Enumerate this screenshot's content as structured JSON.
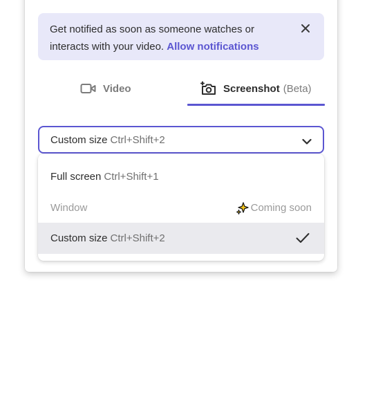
{
  "notification": {
    "message": "Get notified as soon as someone watches or interacts with your video.",
    "link": "Allow notifications",
    "close_icon": "close-icon"
  },
  "tabs": [
    {
      "label": "Video",
      "icon": "video-camera-icon",
      "selected": false
    },
    {
      "label": "Screenshot",
      "suffix": "(Beta)",
      "icon": "camera-icon",
      "selected": true
    }
  ],
  "capture_select": {
    "value": "Custom size",
    "shortcut": "Ctrl+Shift+2",
    "icon": "chevron-down-icon"
  },
  "capture_menu": {
    "items": [
      {
        "label": "Full screen",
        "shortcut": "Ctrl+Shift+1",
        "disabled": false,
        "selected": false
      },
      {
        "label": "Window",
        "badge": "Coming soon",
        "badge_icon": "sparkles-icon",
        "disabled": true,
        "selected": false
      },
      {
        "label": "Custom size",
        "shortcut": "Ctrl+Shift+2",
        "disabled": false,
        "selected": true,
        "icon": "checkmark-icon"
      }
    ]
  },
  "colors": {
    "accent": "#5b56d1",
    "notice_bg": "#e8e8f9",
    "selected_bg": "#eaeaee"
  }
}
